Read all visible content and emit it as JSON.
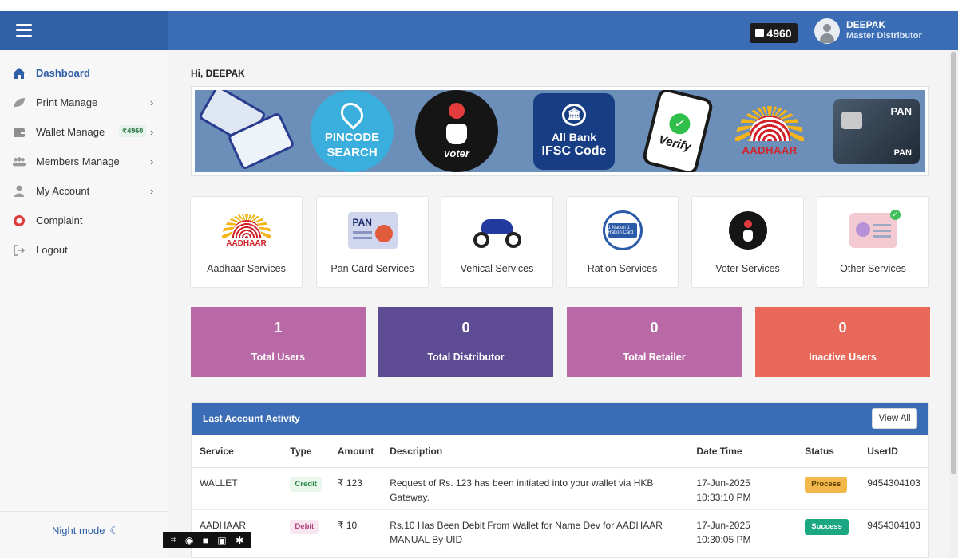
{
  "header": {
    "wallet_balance": "4960",
    "user_name": "DEEPAK",
    "user_role": "Master Distributor"
  },
  "sidebar": {
    "items": [
      {
        "label": "Dashboard",
        "icon": "home-icon"
      },
      {
        "label": "Print Manage",
        "icon": "leaf-icon"
      },
      {
        "label": "Wallet Manage",
        "icon": "wallet-icon",
        "badge": "₹4960"
      },
      {
        "label": "Members Manage",
        "icon": "users-icon"
      },
      {
        "label": "My Account",
        "icon": "user-icon"
      },
      {
        "label": "Complaint",
        "icon": "headset-icon"
      },
      {
        "label": "Logout",
        "icon": "logout-icon"
      }
    ],
    "night_mode": "Night mode",
    "chevron": "›"
  },
  "main": {
    "greeting": "Hi, DEEPAK"
  },
  "banner": {
    "pincode_line1": "PINCODE",
    "pincode_line2": "SEARCH",
    "voter_text": "voter",
    "ifsc_line1": "All Bank",
    "ifsc_line2": "IFSC Code",
    "verify_text": "Verify",
    "aadhaar_text": "AADHAAR",
    "pan_text": "PAN",
    "pan_sub": "PAN"
  },
  "services": [
    {
      "label": "Aadhaar Services",
      "icon": "aadhaar-icon"
    },
    {
      "label": "Pan Card Services",
      "icon": "pan-card-icon"
    },
    {
      "label": "Vehical Services",
      "icon": "motorbike-icon"
    },
    {
      "label": "Ration Services",
      "icon": "ration-card-icon"
    },
    {
      "label": "Voter Services",
      "icon": "voter-icon"
    },
    {
      "label": "Other Services",
      "icon": "id-card-icon"
    }
  ],
  "service_icon_text": {
    "aadhaar": "AADHAAR",
    "pan": "PAN",
    "ration": "1 Nation 1 Ration Card"
  },
  "stats": [
    {
      "value": "1",
      "label": "Total Users",
      "color": "#b96aa6"
    },
    {
      "value": "0",
      "label": "Total Distributor",
      "color": "#5d4c93"
    },
    {
      "value": "0",
      "label": "Total Retailer",
      "color": "#b96aa6"
    },
    {
      "value": "0",
      "label": "Inactive Users",
      "color": "#e8695a"
    }
  ],
  "activity": {
    "title": "Last Account Activity",
    "view_all": "View All",
    "columns": [
      "Service",
      "Type",
      "Amount",
      "Description",
      "Date Time",
      "Status",
      "UserID"
    ],
    "rows": [
      {
        "service": "WALLET",
        "type": "Credit",
        "amount": "₹ 123",
        "description": "Request of Rs. 123 has been initiated into your wallet via HKB Gateway.",
        "datetime": "17-Jun-2025 10:33:10 PM",
        "status": "Process",
        "userid": "9454304103"
      },
      {
        "service": "AADHAAR",
        "type": "Debit",
        "amount": "₹ 10",
        "description": "Rs.10 Has Been Debit From Wallet for Name Dev for AADHAAR MANUAL By UID",
        "datetime": "17-Jun-2025 10:30:05 PM",
        "status": "Success",
        "userid": "9454304103"
      }
    ]
  },
  "colors": {
    "header": "#3a6db5",
    "header_left": "#2f5fa6",
    "accent": "#2f5fa6"
  }
}
